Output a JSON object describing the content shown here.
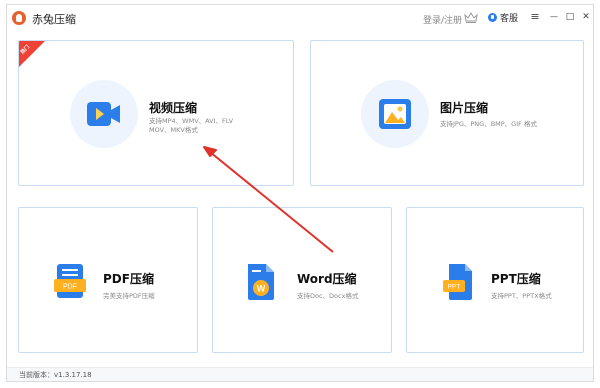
{
  "window": {
    "title": "赤兔压缩",
    "login_label": "登录/注册",
    "service_label": "客服",
    "min_glyph": "—",
    "max_glyph": "□",
    "close_glyph": "✕",
    "menu_glyph": "≡"
  },
  "cards": {
    "video": {
      "title": "视频压缩",
      "desc_line1": "支持MP4、WMV、AVI、FLV",
      "desc_line2": "MOV、MKV格式",
      "badge": "热门",
      "icon": "video-icon"
    },
    "image": {
      "title": "图片压缩",
      "desc": "支持JPG、PNG、BMP、GIF 格式",
      "icon": "image-icon"
    },
    "pdf": {
      "title": "PDF压缩",
      "desc": "完美支持PDF压缩",
      "icon_text": "PDF",
      "icon": "pdf-file-icon"
    },
    "word": {
      "title": "Word压缩",
      "desc": "支持Doc、Docx格式",
      "icon_text": "W",
      "icon": "word-file-icon"
    },
    "ppt": {
      "title": "PPT压缩",
      "desc": "支持PPT、PPTX格式",
      "icon_text": "PPT",
      "icon": "ppt-file-icon"
    }
  },
  "footer": {
    "version": "当前版本：v1.3.17.18"
  },
  "colors": {
    "accent": "#2b7de9",
    "hot": "#ef4135",
    "arrow": "#e0312b",
    "card_border": "#c9dcf3"
  }
}
